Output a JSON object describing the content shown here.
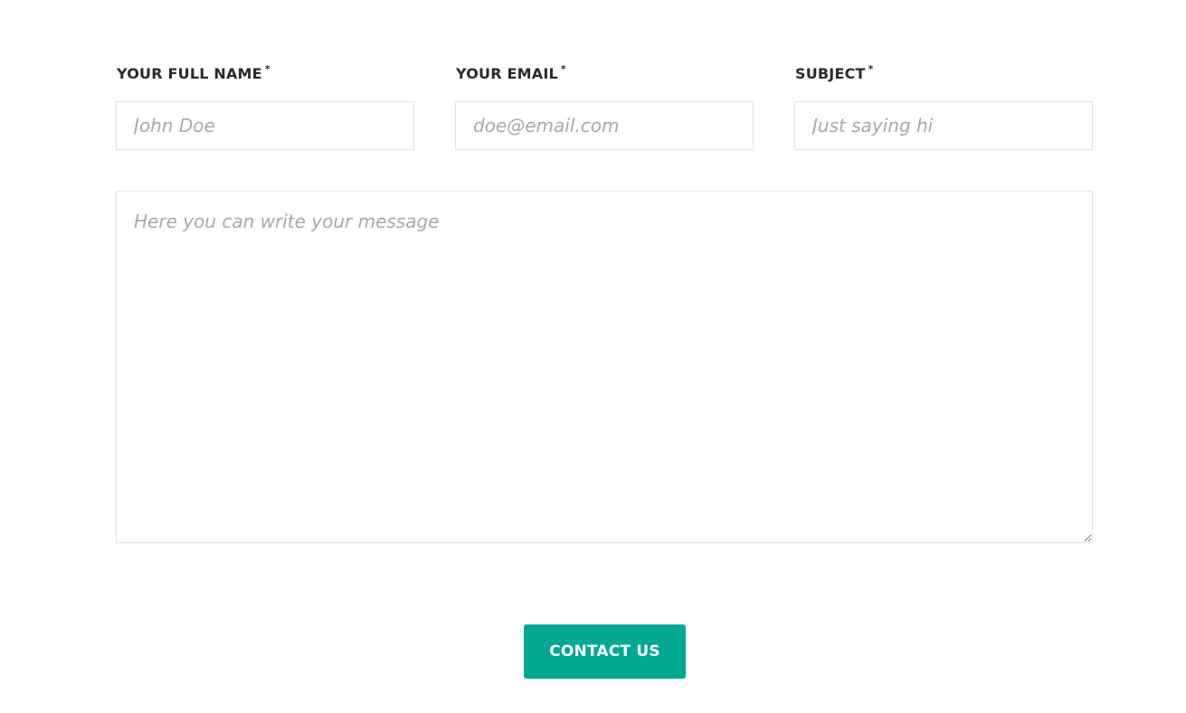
{
  "form": {
    "name_field": {
      "label": "YOUR FULL NAME",
      "required_mark": "*",
      "placeholder": "John Doe",
      "value": ""
    },
    "email_field": {
      "label": "YOUR EMAIL",
      "required_mark": "*",
      "placeholder": "doe@email.com",
      "value": ""
    },
    "subject_field": {
      "label": "SUBJECT",
      "required_mark": "*",
      "placeholder": "Just saying hi",
      "value": ""
    },
    "message_field": {
      "placeholder": "Here you can write your message",
      "value": ""
    },
    "submit_label": "CONTACT US"
  },
  "colors": {
    "accent": "#00a98f",
    "label_text": "#2b2b2b",
    "placeholder_text": "#a9a9a9",
    "input_border": "#e4e4e4"
  }
}
